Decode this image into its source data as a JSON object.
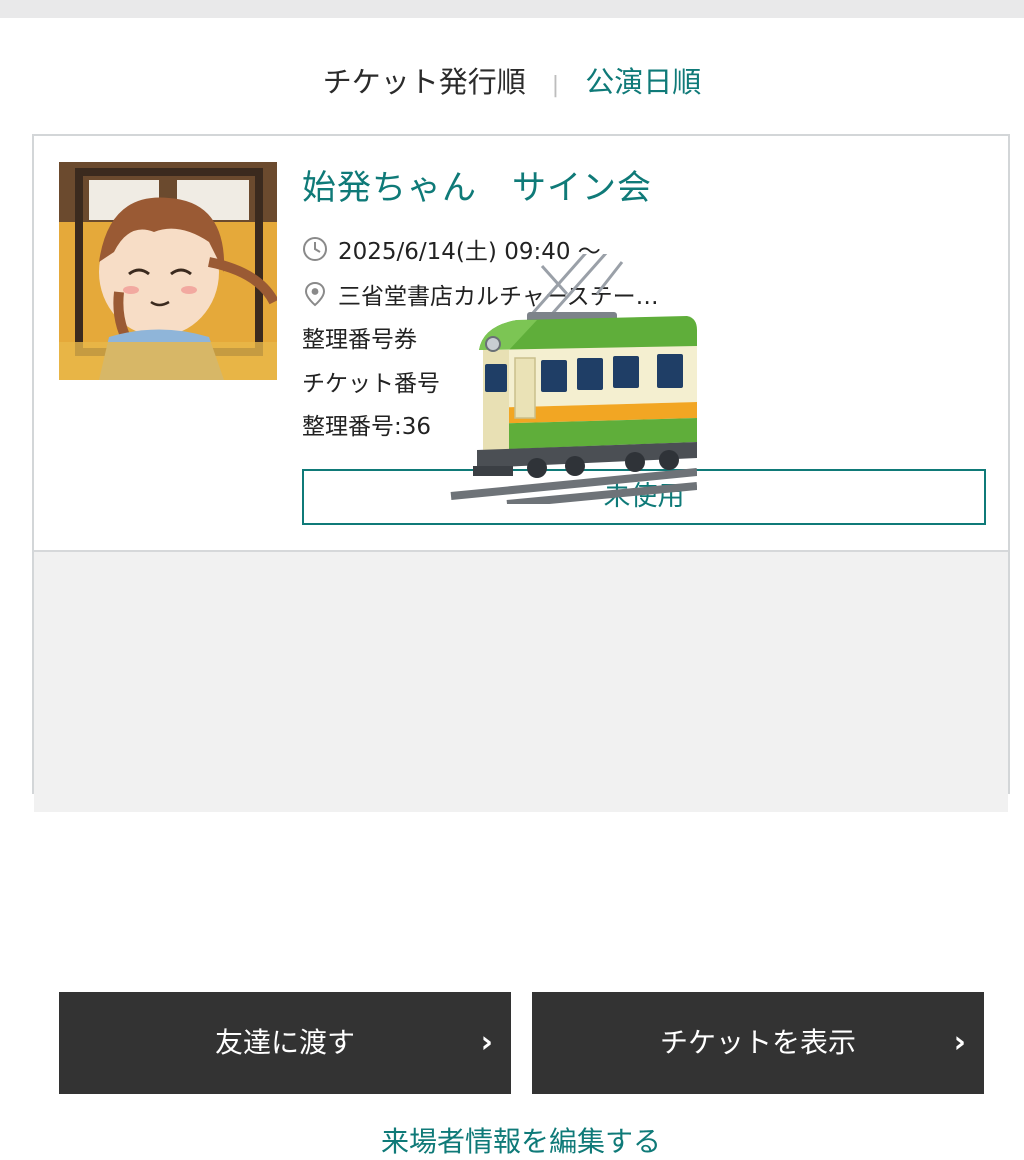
{
  "sort_tabs": {
    "issue_order": "チケット発行順",
    "separator": "|",
    "performance_order": "公演日順"
  },
  "ticket": {
    "title": "始発ちゃん　サイン会",
    "datetime": "2025/6/14(土) 09:40 〜",
    "venue": "三省堂書店カルチャーステー…",
    "ticket_kind": "整理番号券",
    "ticket_number_label": "チケット番号",
    "sequence_number": "整理番号:36",
    "status": "未使用"
  },
  "actions": {
    "transfer": "友達に渡す",
    "show_ticket": "チケットを表示",
    "edit_visitor": "来場者情報を編集する",
    "chevron": "›"
  },
  "icons": {
    "clock": "clock-icon",
    "pin": "map-pin-icon",
    "chevron": "chevron-right-icon"
  },
  "colors": {
    "accent": "#0f7a78",
    "button_bg": "#333333",
    "bottom_panel_bg": "#f1f1f1"
  }
}
